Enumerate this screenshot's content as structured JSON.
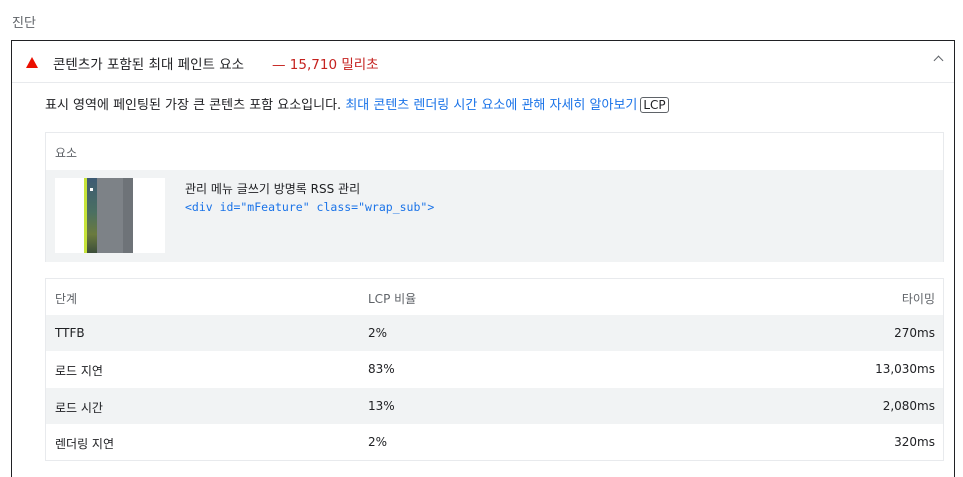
{
  "section": {
    "title": "진단"
  },
  "audit": {
    "title": "콘텐츠가 포함된 최대 페인트 요소",
    "value": "— 15,710 밀리초",
    "icon": "warning-triangle-icon",
    "status_color": "#eb0f00",
    "description": "표시 영역에 페인팅된 가장 큰 콘텐츠 포함 요소입니다. ",
    "link_text": "최대 콘텐츠 렌더링 시간 요소에 관해 자세히 알아보기",
    "badge": "LCP",
    "link_color": "#1a73e8"
  },
  "element_table": {
    "header": "요소",
    "element_label": "관리 메뉴 글쓰기 방명록 RSS 관리",
    "element_code": "<div id=\"mFeature\" class=\"wrap_sub\">"
  },
  "phase_table": {
    "headers": [
      "단계",
      "LCP 비율",
      "타이밍"
    ],
    "rows": [
      [
        "TTFB",
        "2%",
        "270ms"
      ],
      [
        "로드 지연",
        "83%",
        "13,030ms"
      ],
      [
        "로드 시간",
        "13%",
        "2,080ms"
      ],
      [
        "렌더링 지연",
        "2%",
        "320ms"
      ]
    ]
  }
}
